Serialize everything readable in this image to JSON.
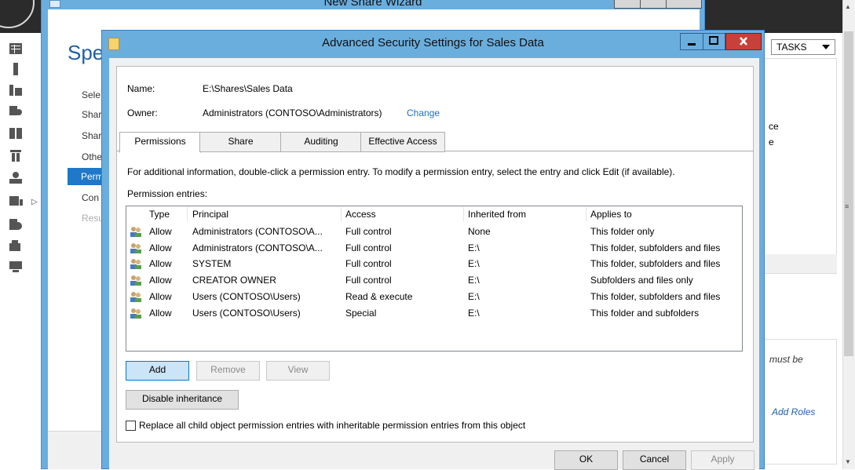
{
  "server_manager": {
    "tasks_label": "TASKS",
    "frag_1": "ce",
    "frag_2": "e",
    "italic_1": "must be",
    "italic_2": "Add Roles"
  },
  "wizard": {
    "title": "New Share Wizard",
    "heading": "Spec",
    "steps": [
      "Sele",
      "Shar",
      "Shar",
      "Othe",
      "Perm",
      "Con",
      "Resu"
    ]
  },
  "dialog": {
    "title": "Advanced Security Settings for Sales Data",
    "name_label": "Name:",
    "name_value": "E:\\Shares\\Sales Data",
    "owner_label": "Owner:",
    "owner_value": "Administrators (CONTOSO\\Administrators)",
    "change_link": "Change",
    "tabs": [
      "Permissions",
      "Share",
      "Auditing",
      "Effective Access"
    ],
    "info_text": "For additional information, double-click a permission entry. To modify a permission entry, select the entry and click Edit (if available).",
    "entries_label": "Permission entries:",
    "columns": [
      "Type",
      "Principal",
      "Access",
      "Inherited from",
      "Applies to"
    ],
    "rows": [
      {
        "type": "Allow",
        "principal": "Administrators (CONTOSO\\A...",
        "access": "Full control",
        "inherited": "None",
        "applies": "This folder only"
      },
      {
        "type": "Allow",
        "principal": "Administrators (CONTOSO\\A...",
        "access": "Full control",
        "inherited": "E:\\",
        "applies": "This folder, subfolders and files"
      },
      {
        "type": "Allow",
        "principal": "SYSTEM",
        "access": "Full control",
        "inherited": "E:\\",
        "applies": "This folder, subfolders and files"
      },
      {
        "type": "Allow",
        "principal": "CREATOR OWNER",
        "access": "Full control",
        "inherited": "E:\\",
        "applies": "Subfolders and files only"
      },
      {
        "type": "Allow",
        "principal": "Users (CONTOSO\\Users)",
        "access": "Read & execute",
        "inherited": "E:\\",
        "applies": "This folder, subfolders and files"
      },
      {
        "type": "Allow",
        "principal": "Users (CONTOSO\\Users)",
        "access": "Special",
        "inherited": "E:\\",
        "applies": "This folder and subfolders"
      }
    ],
    "add_label": "Add",
    "remove_label": "Remove",
    "view_label": "View",
    "disable_inheritance_label": "Disable inheritance",
    "replace_checkbox_label": "Replace all child object permission entries with inheritable permission entries from this object",
    "ok_label": "OK",
    "cancel_label": "Cancel",
    "apply_label": "Apply"
  }
}
